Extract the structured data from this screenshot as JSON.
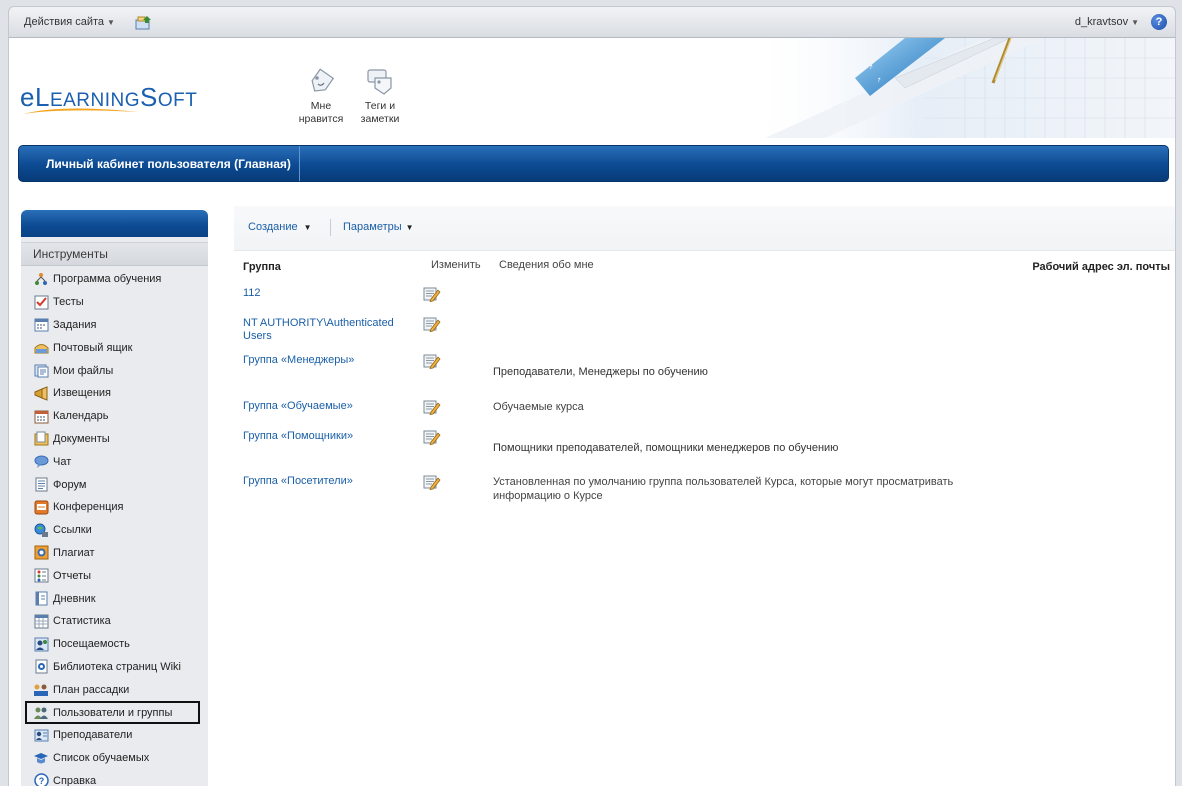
{
  "topbar": {
    "site_actions": "Действия сайта",
    "user": "d_kravtsov"
  },
  "header": {
    "logo_text": "eLEARNINGSOFT",
    "logo_parts": {
      "e": "e",
      "L": "L",
      "earning": "EARNING",
      "S": "S",
      "oft": "OFT"
    },
    "like_label_1": "Мне",
    "like_label_2": "нравится",
    "tags_label_1": "Теги и",
    "tags_label_2": "заметки"
  },
  "titlebar": {
    "title": "Личный кабинет пользователя (Главная)"
  },
  "leftnav": {
    "section": "Инструменты",
    "items": [
      {
        "label": "Программа обучения",
        "icon": "tree-icon"
      },
      {
        "label": "Тесты",
        "icon": "test-icon"
      },
      {
        "label": "Задания",
        "icon": "tasks-icon"
      },
      {
        "label": "Почтовый ящик",
        "icon": "mailbox-icon"
      },
      {
        "label": "Мои файлы",
        "icon": "files-icon"
      },
      {
        "label": "Извещения",
        "icon": "megaphone-icon"
      },
      {
        "label": "Календарь",
        "icon": "calendar-icon"
      },
      {
        "label": "Документы",
        "icon": "documents-icon"
      },
      {
        "label": "Чат",
        "icon": "chat-icon"
      },
      {
        "label": "Форум",
        "icon": "forum-icon"
      },
      {
        "label": "Конференция",
        "icon": "conference-icon"
      },
      {
        "label": "Ссылки",
        "icon": "links-icon"
      },
      {
        "label": "Плагиат",
        "icon": "plagiarism-icon"
      },
      {
        "label": "Отчеты",
        "icon": "reports-icon"
      },
      {
        "label": "Дневник",
        "icon": "diary-icon"
      },
      {
        "label": "Статистика",
        "icon": "statistics-icon"
      },
      {
        "label": "Посещаемость",
        "icon": "attendance-icon"
      },
      {
        "label": "Библиотека страниц Wiki",
        "icon": "wiki-icon"
      },
      {
        "label": "План рассадки",
        "icon": "seating-icon"
      },
      {
        "label": "Пользователи и группы",
        "icon": "users-groups-icon",
        "selected": true
      },
      {
        "label": "Преподаватели",
        "icon": "teachers-icon"
      },
      {
        "label": "Список обучаемых",
        "icon": "students-icon"
      },
      {
        "label": "Справка",
        "icon": "help-icon"
      }
    ]
  },
  "toolbar": {
    "create": "Создание",
    "params": "Параметры"
  },
  "table": {
    "headers": {
      "group": "Группа",
      "edit": "Изменить",
      "about": "Сведения обо мне",
      "email": "Рабочий адрес эл. почты"
    },
    "rows": [
      {
        "group": "112",
        "about": ""
      },
      {
        "group": "NT AUTHORITY\\Authenticated Users",
        "about": ""
      },
      {
        "group": "Группа «Менеджеры»",
        "about": "Преподаватели, Менеджеры по обучению"
      },
      {
        "group": "Группа «Обучаемые»",
        "about": "Обучаемые курса"
      },
      {
        "group": "Группа «Помощники»",
        "about": "Помощники преподавателей, помощники менеджеров по обучению"
      },
      {
        "group": "Группа «Посетители»",
        "about": "Установленная по умолчанию группа пользователей Курса, которые могут просматривать информацию о Курсе"
      }
    ]
  },
  "colors": {
    "accent_blue": "#0c4a92",
    "link_blue": "#1a5fa8",
    "logo_blue": "#1a5fb0"
  }
}
